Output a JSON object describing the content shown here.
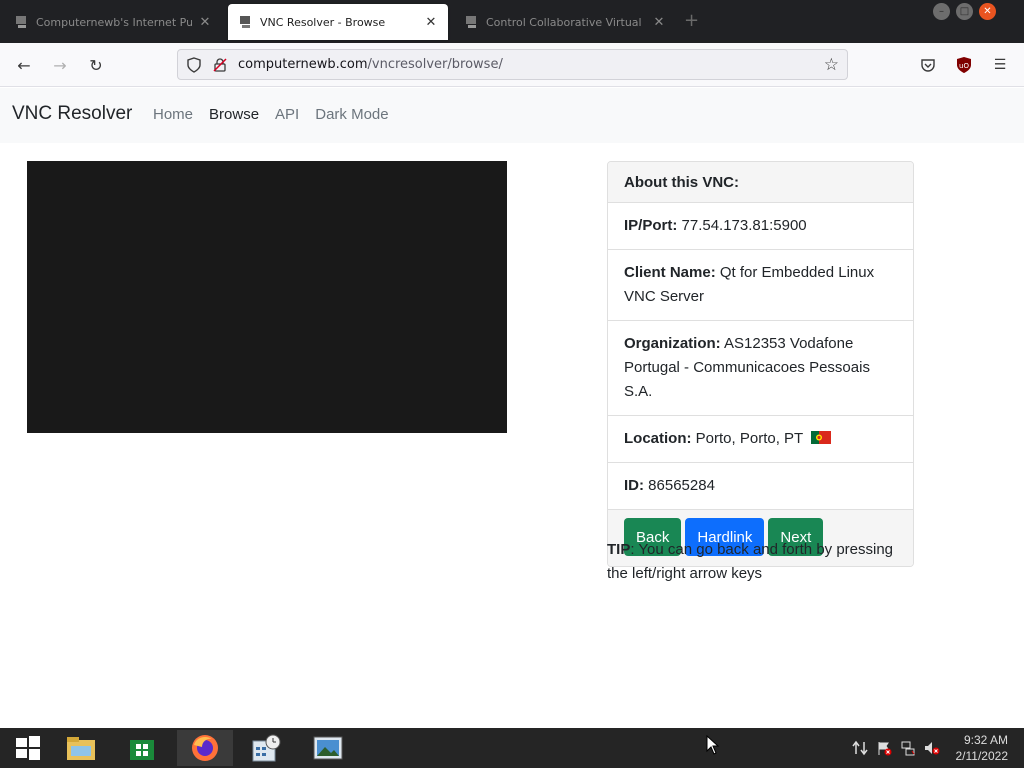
{
  "browser": {
    "tabs": [
      {
        "title": "Computernewb's Internet Pu",
        "active": false
      },
      {
        "title": "VNC Resolver - Browse",
        "active": true
      },
      {
        "title": "Control Collaborative Virtual M",
        "active": false
      }
    ],
    "new_tab_label": "+",
    "url_host": "computernewb.com",
    "url_path": "/vncresolver/browse/"
  },
  "site": {
    "brand": "VNC Resolver",
    "nav": [
      {
        "label": "Home",
        "active": false
      },
      {
        "label": "Browse",
        "active": true
      },
      {
        "label": "API",
        "active": false
      },
      {
        "label": "Dark Mode",
        "active": false
      }
    ]
  },
  "card": {
    "header": "About this VNC:",
    "ip_label": "IP/Port:",
    "ip_value": "77.54.173.81:5900",
    "client_label": "Client Name:",
    "client_value": "Qt for Embedded Linux VNC Server",
    "org_label": "Organization:",
    "org_value": "AS12353 Vodafone Portugal - Communicacoes Pessoais S.A.",
    "location_label": "Location:",
    "location_value": "Porto, Porto, PT",
    "id_label": "ID:",
    "id_value": "86565284",
    "buttons": {
      "back": "Back",
      "hardlink": "Hardlink",
      "next": "Next"
    }
  },
  "tip": {
    "label": "TIP",
    "text": ": You can go back and forth by pressing the left/right arrow keys"
  },
  "taskbar": {
    "time": "9:32 AM",
    "date": "2/11/2022"
  },
  "colors": {
    "green_button": "#198754",
    "blue_button": "#0d6efd",
    "vnc_screen": "#191919"
  }
}
